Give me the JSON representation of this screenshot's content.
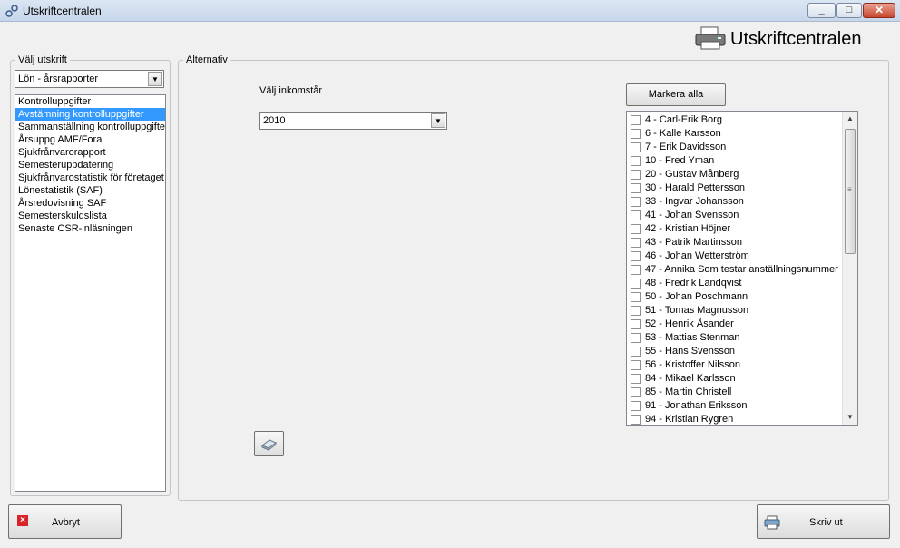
{
  "window": {
    "title": "Utskriftcentralen",
    "minimize": "_",
    "maximize": "□",
    "close": "✕"
  },
  "header": {
    "title": "Utskriftcentralen",
    "icon": "printer-icon"
  },
  "left": {
    "legend": "Välj utskrift",
    "report_type": "Lön - årsrapporter",
    "reports": [
      "Kontrolluppgifter",
      "Avstämning kontrolluppgifter",
      "Sammanställning kontrolluppgifter",
      "Årsuppg AMF/Fora",
      "Sjukfrånvarorapport",
      "Semesteruppdatering",
      "Sjukfrånvarostatistik för företaget",
      "Lönestatistik (SAF)",
      "Årsredovisning SAF",
      "Semesterskuldslista",
      "Senaste CSR-inläsningen"
    ],
    "selected_index": 1
  },
  "right": {
    "legend": "Alternativ",
    "year_label": "Välj inkomstår",
    "year_value": "2010",
    "select_all": "Markera alla",
    "employees": [
      "4 - Carl-Erik Borg",
      "6 - Kalle Karsson",
      "7 - Erik Davidsson",
      "10 - Fred Yman",
      "20 - Gustav Månberg",
      "30 - Harald Pettersson",
      "33 - Ingvar Johansson",
      "41 - Johan Svensson",
      "42 - Kristian Höjner",
      "43 - Patrik Martinsson",
      "46 - Johan Wetterström",
      "47 - Annika Som testar anställningsnummer",
      "48 - Fredrik Landqvist",
      "50 - Johan Poschmann",
      "51 - Tomas Magnusson",
      "52 - Henrik Åsander",
      "53 - Mattias Stenman",
      "55 - Hans Svensson",
      "56 - Kristoffer Nilsson",
      "84 - Mikael Karlsson",
      "85 - Martin Christell",
      "91 - Jonathan Eriksson",
      "94 - Kristian Rygren"
    ]
  },
  "footer": {
    "cancel": "Avbryt",
    "print": "Skriv ut"
  }
}
